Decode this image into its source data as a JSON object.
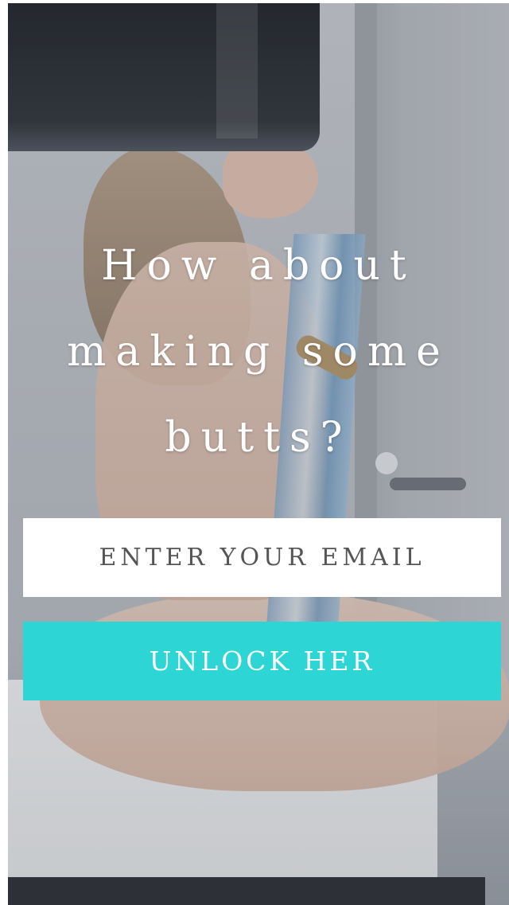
{
  "hero": {
    "description_icon": "photo-background"
  },
  "headline": {
    "text": "How about making some butts?"
  },
  "signup": {
    "email_placeholder": "ENTER YOUR EMAIL",
    "email_value": "",
    "button_label": "UNLOCK HER"
  },
  "colors": {
    "accent": "#2dd6d4",
    "input_background": "#ffffff",
    "headline_text": "#ffffff",
    "placeholder_text": "#555555"
  }
}
